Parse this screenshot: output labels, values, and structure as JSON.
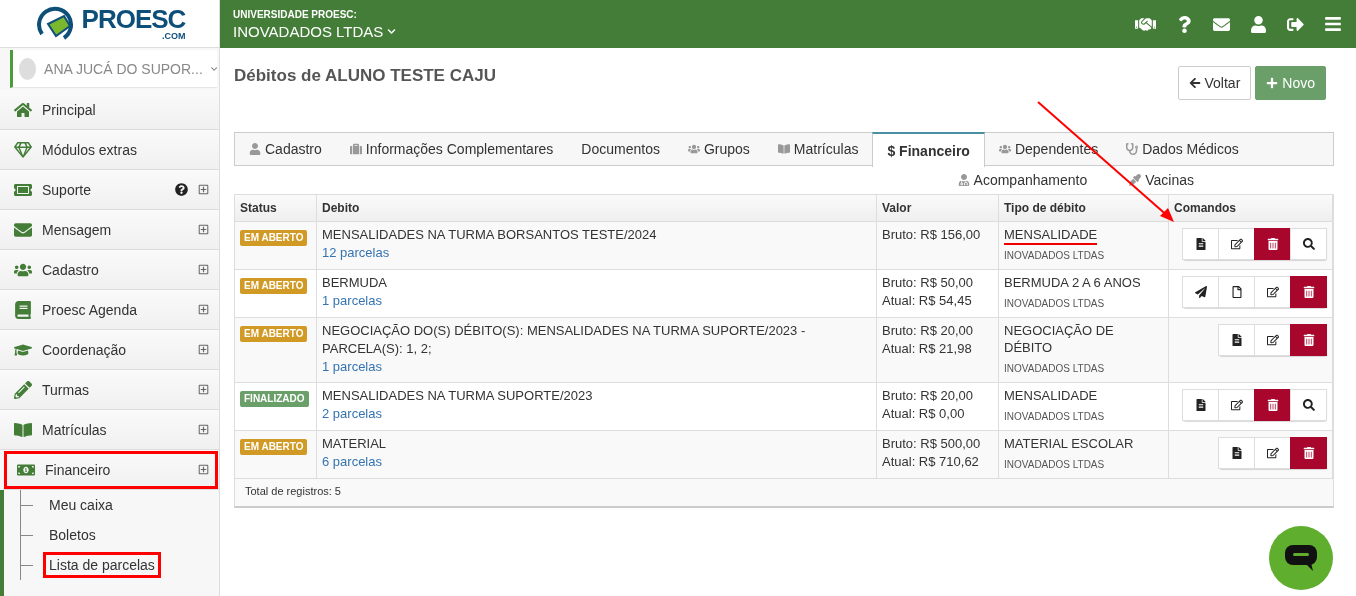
{
  "logo": {
    "name": "PROESC",
    "suffix": ".COM"
  },
  "header": {
    "org_label": "UNIVERSIDADE PROESC:",
    "org_name": "INOVADADOS LTDAS"
  },
  "user": {
    "name": "ANA JUCÁ DO SUPOR..."
  },
  "sidebar": {
    "items": [
      {
        "kind": "home",
        "label": "Principal",
        "expandable": false,
        "help": false,
        "highlighted": false
      },
      {
        "kind": "gem",
        "label": "Módulos extras",
        "expandable": false,
        "help": false,
        "highlighted": false
      },
      {
        "kind": "ticket",
        "label": "Suporte",
        "expandable": true,
        "help": true,
        "highlighted": false
      },
      {
        "kind": "envelope",
        "label": "Mensagem",
        "expandable": true,
        "help": false,
        "highlighted": false
      },
      {
        "kind": "users",
        "label": "Cadastro",
        "expandable": true,
        "help": false,
        "highlighted": false
      },
      {
        "kind": "book",
        "label": "Proesc Agenda",
        "expandable": true,
        "help": false,
        "highlighted": false
      },
      {
        "kind": "cap",
        "label": "Coordenação",
        "expandable": true,
        "help": false,
        "highlighted": false
      },
      {
        "kind": "pencil",
        "label": "Turmas",
        "expandable": true,
        "help": false,
        "highlighted": false
      },
      {
        "kind": "openbook",
        "label": "Matrículas",
        "expandable": true,
        "help": false,
        "highlighted": false
      },
      {
        "kind": "money",
        "label": "Financeiro",
        "expandable": true,
        "help": false,
        "highlighted": true,
        "expanded": true,
        "children": [
          {
            "label": "Meu caixa",
            "highlighted": false
          },
          {
            "label": "Boletos",
            "highlighted": false
          },
          {
            "label": "Lista de parcelas",
            "highlighted": true
          }
        ]
      }
    ]
  },
  "page": {
    "title": "Débitos de ALUNO TESTE CAJU",
    "buttons": [
      {
        "kind": "back",
        "label": "Voltar"
      },
      {
        "kind": "new",
        "label": "Novo"
      }
    ]
  },
  "tab_rows": [
    [
      {
        "kind": "user",
        "label": "Cadastro",
        "selected": false
      },
      {
        "kind": "suitcase",
        "label": "Informações Complementares",
        "selected": false
      },
      {
        "kind": "none",
        "label": "Documentos",
        "selected": false
      },
      {
        "kind": "users",
        "label": "Grupos",
        "selected": false
      },
      {
        "kind": "openbook",
        "label": "Matrículas",
        "selected": false
      },
      {
        "kind": "none",
        "label": "$ Financeiro",
        "selected": true
      },
      {
        "kind": "users",
        "label": "Dependentes",
        "selected": false
      },
      {
        "kind": "stethoscope",
        "label": "Dados Médicos",
        "selected": false
      }
    ],
    [
      {
        "kind": "doctor",
        "label": "Acompanhamento",
        "selected": false
      },
      {
        "kind": "dropper",
        "label": "Vacinas",
        "selected": false
      }
    ]
  ],
  "table": {
    "columns": [
      "Status",
      "Debito",
      "Valor",
      "Tipo de débito",
      "Comandos"
    ],
    "rows": [
      {
        "status": "EM ABERTO",
        "color": "#d09a25",
        "debito": "MENSALIDADES NA TURMA BORSANTOS TESTE/2024",
        "parcelas": "12 parcelas",
        "valor": [
          "Bruto: R$ 156,00"
        ],
        "tipo": "MENSALIDADE",
        "tipo_underlined": true,
        "empresa": "INOVADADOS LTDAS",
        "commands": [
          {
            "kind": "doc"
          },
          {
            "kind": "edit"
          },
          {
            "kind": "delete"
          },
          {
            "kind": "search"
          }
        ]
      },
      {
        "status": "EM ABERTO",
        "color": "#d09a25",
        "debito": "BERMUDA",
        "parcelas": "1 parcelas",
        "valor": [
          "Bruto: R$ 50,00",
          "Atual: R$ 54,45"
        ],
        "tipo": "BERMUDA 2 A 6 ANOS",
        "tipo_underlined": false,
        "empresa": "INOVADADOS LTDAS",
        "commands": [
          {
            "kind": "send"
          },
          {
            "kind": "file"
          },
          {
            "kind": "edit"
          },
          {
            "kind": "delete"
          }
        ]
      },
      {
        "status": "EM ABERTO",
        "color": "#d09a25",
        "debito": "NEGOCIAÇÃO DO(S) DÉBITO(S): MENSALIDADES NA TURMA SUPORTE/2023 - PARCELA(S): 1, 2;",
        "parcelas": "1 parcelas",
        "valor": [
          "Bruto: R$ 20,00",
          "Atual: R$ 21,98"
        ],
        "tipo": "NEGOCIAÇÃO DE DÉBITO",
        "tipo_underlined": false,
        "empresa": "INOVADADOS LTDAS",
        "commands": [
          {
            "kind": "doc"
          },
          {
            "kind": "edit"
          },
          {
            "kind": "delete"
          }
        ]
      },
      {
        "status": "FINALIZADO",
        "color": "#6a9f6a",
        "debito": "MENSALIDADES NA TURMA SUPORTE/2023",
        "parcelas": "2 parcelas",
        "valor": [
          "Bruto: R$ 20,00",
          "Atual: R$ 0,00"
        ],
        "tipo": "MENSALIDADE",
        "tipo_underlined": false,
        "empresa": "INOVADADOS LTDAS",
        "commands": [
          {
            "kind": "doc"
          },
          {
            "kind": "edit"
          },
          {
            "kind": "delete"
          },
          {
            "kind": "search"
          }
        ]
      },
      {
        "status": "EM ABERTO",
        "color": "#d09a25",
        "debito": "MATERIAL",
        "parcelas": "6 parcelas",
        "valor": [
          "Bruto: R$ 500,00",
          "Atual: R$ 710,62"
        ],
        "tipo": "MATERIAL ESCOLAR",
        "tipo_underlined": false,
        "empresa": "INOVADADOS LTDAS",
        "commands": [
          {
            "kind": "doc"
          },
          {
            "kind": "edit"
          },
          {
            "kind": "delete"
          }
        ]
      }
    ],
    "footer": "Total de registros: 5"
  },
  "annotation_arrow": true
}
